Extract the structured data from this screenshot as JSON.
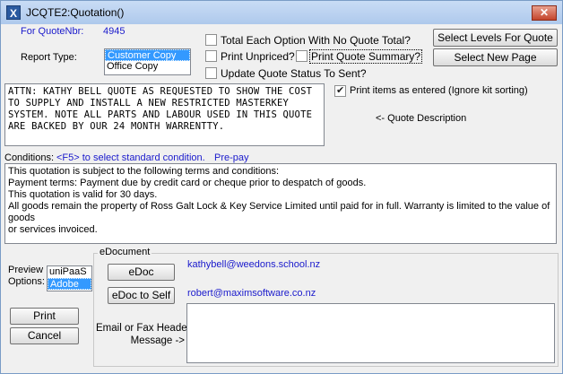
{
  "window": {
    "title": "JCQTE2:Quotation()",
    "close_label": "✕"
  },
  "quote": {
    "label": "For QuoteNbr:",
    "number": "4945"
  },
  "report_type": {
    "label": "Report Type:",
    "options": [
      "Customer Copy",
      "Office Copy"
    ],
    "selected": "Customer Copy"
  },
  "checkboxes": {
    "total_each_option": {
      "label": "Total Each Option With No Quote Total?",
      "checked": false
    },
    "print_unpriced": {
      "label": "Print Unpriced?",
      "checked": false
    },
    "print_quote_summary": {
      "label": "Print Quote Summary?",
      "checked": false
    },
    "update_status": {
      "label": "Update Quote Status To Sent?",
      "checked": false
    },
    "print_as_entered": {
      "label": "Print items as entered (Ignore kit sorting)",
      "checked": true
    }
  },
  "buttons": {
    "select_levels": "Select Levels For Quote",
    "select_page": "Select New Page",
    "edoc": "eDoc",
    "edoc_self": "eDoc to Self",
    "print": "Print",
    "cancel": "Cancel"
  },
  "description": {
    "text": "ATTN: KATHY BELL QUOTE AS REQUESTED TO SHOW THE COST\nTO SUPPLY AND INSTALL A NEW RESTRICTED MASTERKEY\nSYSTEM. NOTE ALL PARTS AND LABOUR USED IN THIS QUOTE\nARE BACKED BY OUR 24 MONTH WARRENTTY.",
    "hint": "<- Quote Description"
  },
  "conditions": {
    "label": "Conditions:",
    "hint": "<F5> to select standard condition.",
    "code": "Pre-pay",
    "text": "This quotation is subject to the following terms and conditions:\nPayment terms: Payment due by credit card or cheque prior to despatch of goods.\nThis quotation is valid for 30 days.\nAll goods remain the property of Ross Galt Lock & Key Service Limited until paid for in full. Warranty is limited to the value of goods\nor services invoiced."
  },
  "preview": {
    "label": "Preview\nOptions:",
    "options": [
      "uniPaaS",
      "Adobe"
    ],
    "selected": "Adobe"
  },
  "edocument": {
    "group_label": "eDocument",
    "email_to": "kathybell@weedons.school.nz",
    "email_self": "robert@maximsoftware.co.nz",
    "message_label": "Email or Fax Header\nMessage ->",
    "message": ""
  }
}
